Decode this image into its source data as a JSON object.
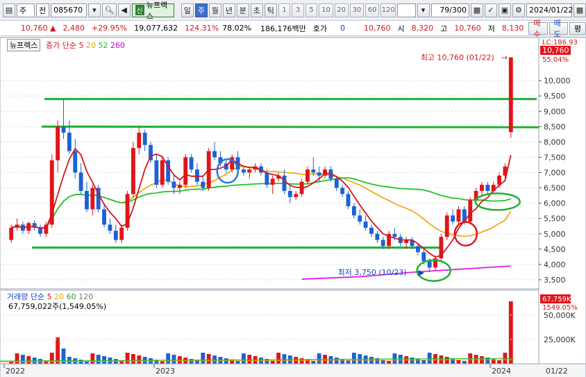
{
  "toolbar": {
    "market": "주",
    "type": "전",
    "code": "085670",
    "badge": "신",
    "name": "뉴프렉스",
    "periods": [
      "일",
      "주",
      "월",
      "년",
      "분",
      "초",
      "틱"
    ],
    "active_period": "주",
    "intervals": [
      "1",
      "3",
      "5",
      "10",
      "20",
      "30",
      "60",
      "120"
    ],
    "count": "79",
    "count_total": "/300",
    "date": "2024/01/22"
  },
  "quote": {
    "price": "10,760",
    "change": "2,480",
    "change_pct": "+29.95%",
    "volume": "19,077,632",
    "vol_ratio": "124.31%",
    "turnover_ratio": "78.02%",
    "amount": "186,176백만",
    "hoga_label": "호가",
    "hoga_value": "0",
    "price2": "10,760",
    "open_label": "시",
    "open": "8,320",
    "high_label": "고",
    "high": "10,760",
    "low_label": "저",
    "low": "8,130",
    "buy_label": "매수",
    "sell_label": "매도",
    "eval_label": "평"
  },
  "price_panel": {
    "stock_box": "뉴프렉스",
    "legend_prefix": "종가 단순",
    "ma_periods": [
      "5",
      "20",
      "52",
      "260"
    ],
    "high_annotation": "최고 10,760 (01/22)",
    "low_annotation": "최저 3,750 (10/23)",
    "lc_label": "LC:186.93",
    "current_tag": "10,760",
    "current_pct": "55.04%",
    "y_ticks": [
      "10,000",
      "9,500",
      "9,000",
      "8,500",
      "8,000",
      "7,500",
      "7,000",
      "6,500",
      "6,000",
      "5,500",
      "5,000",
      "4,500",
      "4,000",
      "3,500"
    ]
  },
  "volume_panel": {
    "title": "거래량",
    "legend_prefix": "단순",
    "ma_periods": [
      "5",
      "20",
      "60",
      "120"
    ],
    "volume_text": "67,759,022주(1,549.05%)",
    "tag_value": "67,759K",
    "tag_pct": "1549.05%",
    "y_ticks": [
      "50,000K",
      "25,000K"
    ]
  },
  "x_axis": {
    "labels": [
      "2022",
      "2023",
      "2024"
    ],
    "last_date": "01/22"
  },
  "chart_data": {
    "type": "candlestick",
    "x_labels": [
      "2022",
      "2023",
      "2024"
    ],
    "y_range": [
      3250,
      11000
    ],
    "weekly_ohlc_approx": [
      [
        4800,
        5300,
        4700,
        5200
      ],
      [
        5200,
        5500,
        5100,
        5300
      ],
      [
        5300,
        5400,
        5000,
        5100
      ],
      [
        5100,
        5400,
        5000,
        5350
      ],
      [
        5350,
        5450,
        5100,
        5200
      ],
      [
        5200,
        5300,
        4900,
        5000
      ],
      [
        5000,
        5400,
        4900,
        5300
      ],
      [
        5300,
        7600,
        5200,
        7400
      ],
      [
        7400,
        8700,
        7000,
        8500
      ],
      [
        8500,
        9400,
        8100,
        8300
      ],
      [
        8300,
        8700,
        7600,
        7700
      ],
      [
        7700,
        8100,
        6800,
        7000
      ],
      [
        7000,
        7300,
        6300,
        6400
      ],
      [
        6400,
        6700,
        5700,
        5800
      ],
      [
        5800,
        6600,
        5600,
        6500
      ],
      [
        6500,
        6600,
        5700,
        5800
      ],
      [
        5800,
        6000,
        5200,
        5300
      ],
      [
        5300,
        5500,
        5000,
        5100
      ],
      [
        5100,
        5300,
        4700,
        4800
      ],
      [
        4800,
        5300,
        4700,
        5200
      ],
      [
        5200,
        6400,
        5100,
        6300
      ],
      [
        6300,
        8000,
        6200,
        7800
      ],
      [
        7800,
        8500,
        7600,
        8300
      ],
      [
        8300,
        8400,
        7700,
        7900
      ],
      [
        7900,
        8000,
        7300,
        7400
      ],
      [
        7400,
        7600,
        6500,
        6600
      ],
      [
        6600,
        7500,
        6500,
        7400
      ],
      [
        7400,
        7500,
        6600,
        6700
      ],
      [
        6700,
        6900,
        6300,
        6500
      ],
      [
        6500,
        6700,
        6300,
        6600
      ],
      [
        6600,
        7600,
        6500,
        7500
      ],
      [
        7500,
        7600,
        7000,
        7100
      ],
      [
        7100,
        7300,
        6600,
        6700
      ],
      [
        6700,
        6900,
        6400,
        6500
      ],
      [
        6500,
        7800,
        6400,
        7700
      ],
      [
        7700,
        8000,
        7400,
        7500
      ],
      [
        7500,
        7700,
        7200,
        7300
      ],
      [
        7300,
        7400,
        7000,
        7100
      ],
      [
        7100,
        7600,
        7000,
        7500
      ],
      [
        7500,
        7700,
        7000,
        7100
      ],
      [
        7100,
        7200,
        6900,
        7000
      ],
      [
        7000,
        7200,
        6800,
        7100
      ],
      [
        7100,
        7300,
        7000,
        7200
      ],
      [
        7200,
        7300,
        6900,
        7000
      ],
      [
        7000,
        7100,
        6500,
        6600
      ],
      [
        6600,
        6900,
        6300,
        6800
      ],
      [
        6800,
        7000,
        6700,
        6900
      ],
      [
        6900,
        7100,
        6300,
        6400
      ],
      [
        6400,
        6600,
        6000,
        6200
      ],
      [
        6200,
        6400,
        6100,
        6300
      ],
      [
        6300,
        6800,
        6200,
        6700
      ],
      [
        6700,
        7200,
        6600,
        7100
      ],
      [
        7100,
        7500,
        6900,
        7000
      ],
      [
        7000,
        7200,
        6700,
        6900
      ],
      [
        6900,
        7200,
        6800,
        7100
      ],
      [
        7100,
        7200,
        6700,
        6800
      ],
      [
        6800,
        6900,
        6400,
        6500
      ],
      [
        6500,
        6600,
        6200,
        6300
      ],
      [
        6300,
        6400,
        5800,
        5900
      ],
      [
        5900,
        6000,
        5500,
        5600
      ],
      [
        5600,
        5800,
        5300,
        5400
      ],
      [
        5400,
        5600,
        5100,
        5200
      ],
      [
        5200,
        5300,
        4900,
        5000
      ],
      [
        5000,
        5100,
        4700,
        4800
      ],
      [
        4800,
        4900,
        4500,
        4600
      ],
      [
        4600,
        5100,
        4500,
        5000
      ],
      [
        5000,
        5200,
        4800,
        4900
      ],
      [
        4900,
        5000,
        4600,
        4700
      ],
      [
        4700,
        4900,
        4500,
        4800
      ],
      [
        4800,
        4900,
        4500,
        4600
      ],
      [
        4600,
        4700,
        4300,
        4400
      ],
      [
        4400,
        4500,
        4000,
        4100
      ],
      [
        4100,
        4200,
        3750,
        3900
      ],
      [
        3900,
        4300,
        3800,
        4200
      ],
      [
        4200,
        5000,
        4100,
        4900
      ],
      [
        4900,
        5700,
        4800,
        5600
      ],
      [
        5600,
        5800,
        5300,
        5400
      ],
      [
        5400,
        5900,
        5300,
        5800
      ],
      [
        5800,
        5900,
        5300,
        5400
      ],
      [
        5400,
        6200,
        5300,
        6100
      ],
      [
        6100,
        6500,
        6000,
        6400
      ],
      [
        6400,
        6700,
        6200,
        6600
      ],
      [
        6600,
        6700,
        6300,
        6400
      ],
      [
        6400,
        6700,
        6300,
        6600
      ],
      [
        6600,
        7000,
        6500,
        6900
      ],
      [
        6900,
        7300,
        6700,
        7200
      ],
      [
        8320,
        10760,
        8130,
        10760
      ]
    ],
    "horizontal_lines": [
      9400,
      8500,
      4550
    ],
    "volume_current": "67,759,022"
  }
}
